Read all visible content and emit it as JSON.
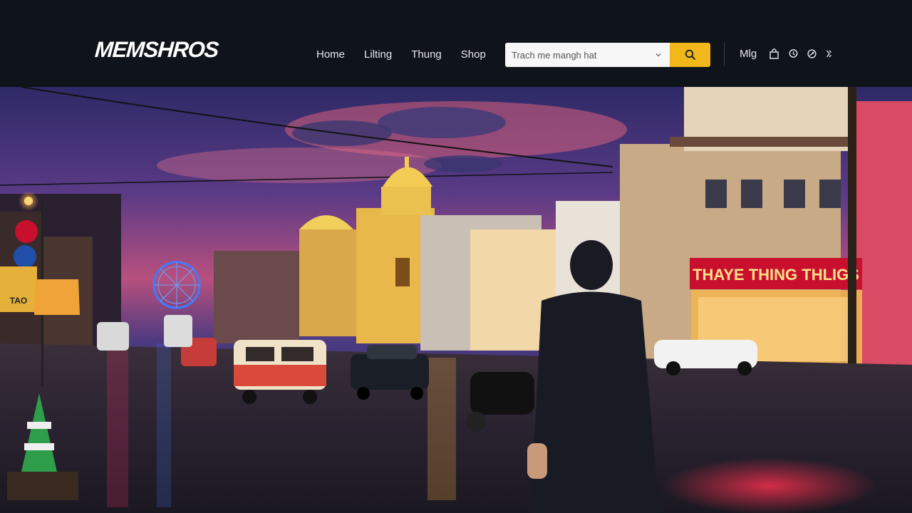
{
  "brand": {
    "name": "MEMSHROS"
  },
  "nav": {
    "items": [
      {
        "label": "Home"
      },
      {
        "label": "Lilting"
      },
      {
        "label": "Thung"
      },
      {
        "label": "Shop"
      }
    ]
  },
  "search": {
    "placeholder": "Trach me mangh hat"
  },
  "user": {
    "label": "Mlg"
  },
  "utility_icons": [
    "bag-icon",
    "location-icon",
    "globe-icon",
    "currency-icon"
  ],
  "hero": {
    "shop_sign": "THAYE THING THLIGS",
    "left_sign_text": "TAO",
    "colors": {
      "accent": "#f2b81b",
      "sign_red": "#c8102e",
      "sky_top": "#3a2f6e",
      "sky_mid": "#b04a7a"
    }
  }
}
